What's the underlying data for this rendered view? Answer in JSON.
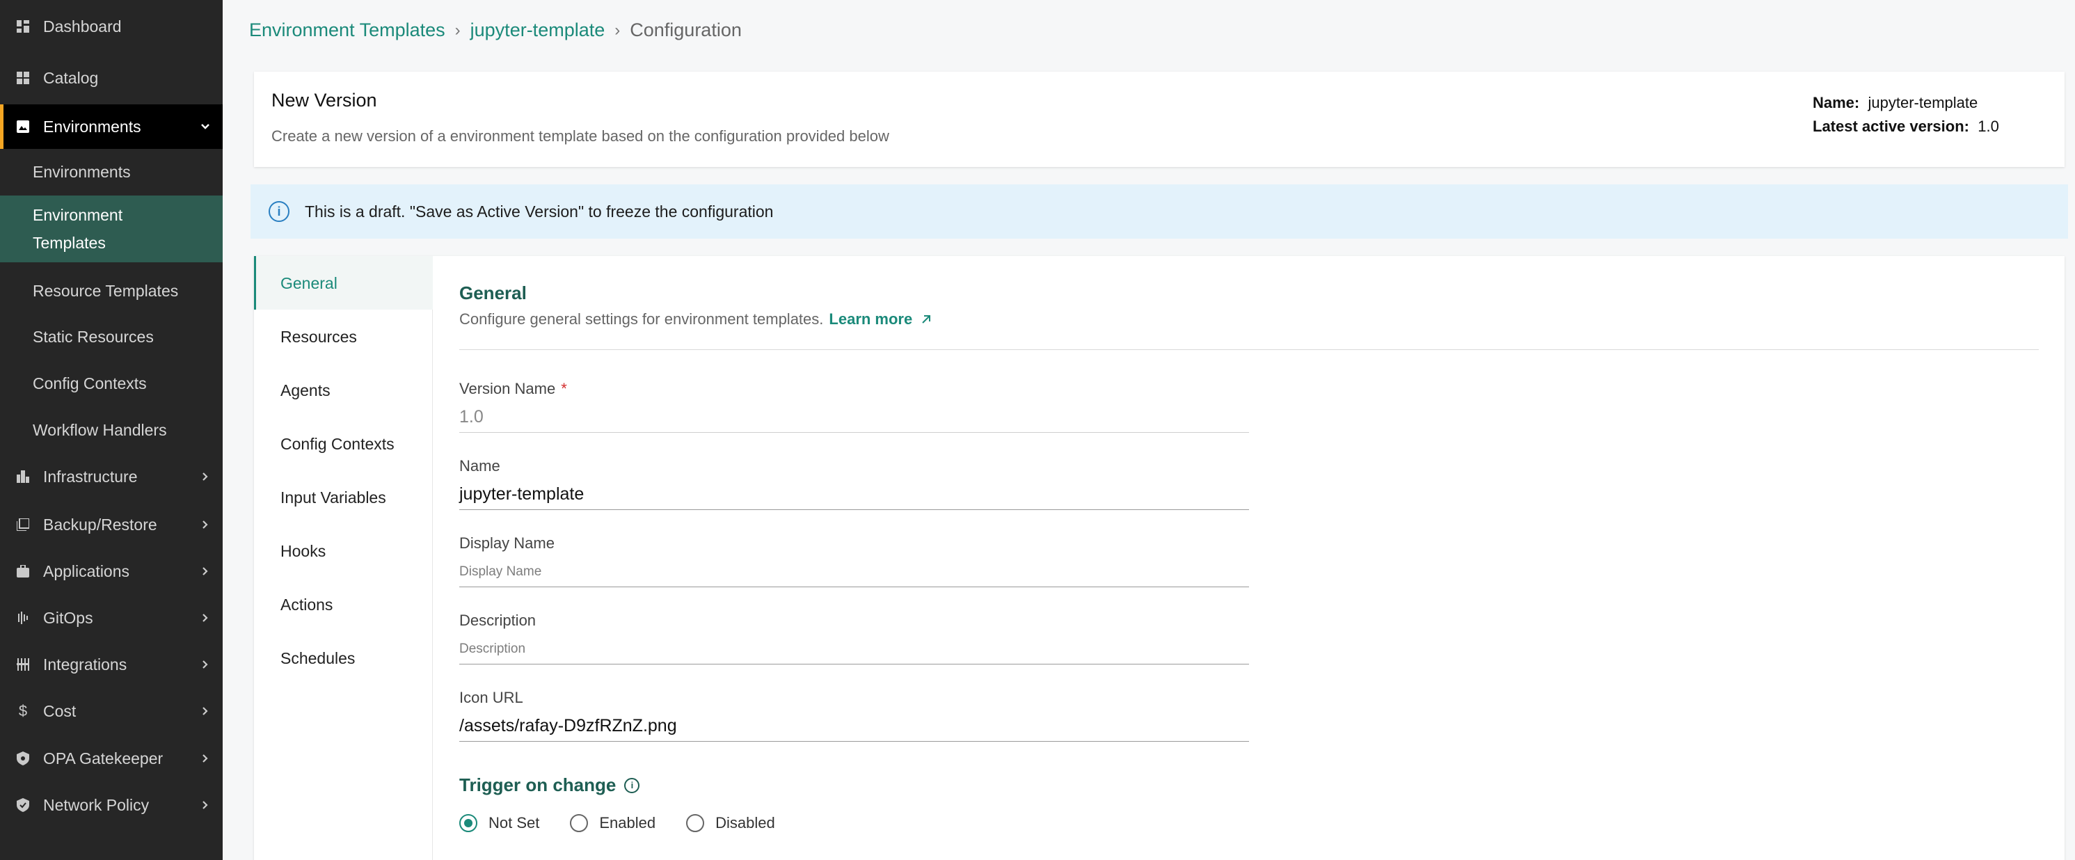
{
  "sidebar": {
    "items": [
      {
        "label": "Dashboard",
        "icon": "dashboard-icon"
      },
      {
        "label": "Catalog",
        "icon": "catalog-icon"
      },
      {
        "label": "Environments",
        "icon": "environments-icon",
        "expanded": true
      },
      {
        "label": "Infrastructure",
        "icon": "infrastructure-icon"
      },
      {
        "label": "Backup/Restore",
        "icon": "backup-icon"
      },
      {
        "label": "Applications",
        "icon": "applications-icon"
      },
      {
        "label": "GitOps",
        "icon": "gitops-icon"
      },
      {
        "label": "Integrations",
        "icon": "integrations-icon"
      },
      {
        "label": "Cost",
        "icon": "dollar-icon"
      },
      {
        "label": "OPA Gatekeeper",
        "icon": "shield-icon"
      },
      {
        "label": "Network Policy",
        "icon": "shield-check-icon"
      }
    ],
    "sub_items": [
      {
        "label": "Environments"
      },
      {
        "label": "Environment Templates",
        "line1": "Environment",
        "line2": "Templates",
        "selected": true
      },
      {
        "label": "Resource Templates"
      },
      {
        "label": "Static Resources"
      },
      {
        "label": "Config Contexts"
      },
      {
        "label": "Workflow Handlers"
      }
    ],
    "accent_color": "#f5a623",
    "selected_color": "#2e5c51"
  },
  "breadcrumb": {
    "items": [
      "Environment Templates",
      "jupyter-template",
      "Configuration"
    ],
    "separator": "›"
  },
  "header": {
    "title": "New Version",
    "description": "Create a new version of a environment template based on the configuration provided below",
    "name_label": "Name:",
    "name_value": "jupyter-template",
    "version_label": "Latest active version:",
    "version_value": "1.0"
  },
  "banner": {
    "text": "This is a draft. \"Save as Active Version\" to freeze the configuration",
    "icon": "info-icon"
  },
  "tabs": [
    {
      "label": "General",
      "active": true
    },
    {
      "label": "Resources"
    },
    {
      "label": "Agents"
    },
    {
      "label": "Config Contexts"
    },
    {
      "label": "Input Variables"
    },
    {
      "label": "Hooks"
    },
    {
      "label": "Actions"
    },
    {
      "label": "Schedules"
    }
  ],
  "general": {
    "title": "General",
    "description": "Configure general settings for environment templates.",
    "learn_more": "Learn more",
    "fields": {
      "version_name": {
        "label": "Version Name",
        "required": "*",
        "value": "1.0"
      },
      "name": {
        "label": "Name",
        "value": "jupyter-template"
      },
      "display_name": {
        "label": "Display Name",
        "placeholder": "Display Name"
      },
      "description": {
        "label": "Description",
        "placeholder": "Description"
      },
      "icon_url": {
        "label": "Icon URL",
        "value": "/assets/rafay-D9zfRZnZ.png"
      }
    },
    "trigger": {
      "title": "Trigger on change",
      "options": [
        "Not Set",
        "Enabled",
        "Disabled"
      ],
      "selected": "Not Set"
    }
  },
  "colors": {
    "brand": "#1b8a7a",
    "heading": "#1e5e53",
    "banner_bg": "#e3f2fb"
  }
}
